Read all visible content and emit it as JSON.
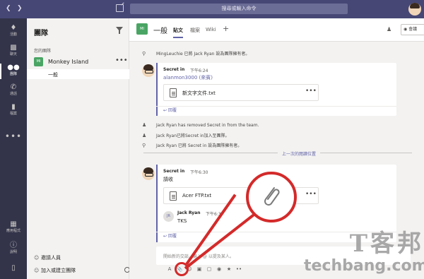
{
  "titlebar": {
    "search_placeholder": "搜尋或輸入命令"
  },
  "rail": {
    "items": [
      {
        "label": "活動",
        "icon": "bell-icon"
      },
      {
        "label": "聊天",
        "icon": "chat-icon"
      },
      {
        "label": "團隊",
        "icon": "teams-icon"
      },
      {
        "label": "通話",
        "icon": "phone-icon"
      },
      {
        "label": "檔案",
        "icon": "files-icon"
      }
    ],
    "more": "•••",
    "apps_label": "應用程式",
    "help_label": "說明"
  },
  "panel": {
    "title": "團隊",
    "section_label": "您的團隊",
    "team": {
      "avatar_text": "MI",
      "name": "Monkey Island",
      "more": "•••"
    },
    "channel": {
      "name": "一般"
    },
    "invite_label": "邀請人員",
    "join_label": "加入或建立團隊"
  },
  "header": {
    "avatar_text": "MI",
    "title": "一般",
    "tabs": [
      "貼文",
      "檔案",
      "Wiki"
    ],
    "add": "+",
    "meet_label": "會議"
  },
  "feed": {
    "sys1": "MingLeuchie 已將 Jack Ryan 設為團隊擁有者。",
    "post1": {
      "author": "Secret in",
      "time": "下午6:24",
      "text": "alanmon3000 (來賓)",
      "file": "新文字文件.txt",
      "reply": "回覆"
    },
    "sys2": "Jack Ryan has removed Secret in from the team.",
    "sys3": "Jack Ryan已將Secret in加入至團隊。",
    "sys4": "Jack Ryan 已將 Secret in 設為團隊擁有者。",
    "divider": "上一次的閱讀位置",
    "post2": {
      "author": "Secret in",
      "time": "下午6:30",
      "text": "請收",
      "file": "Acer FTP.txt",
      "sub_avatar": "JR",
      "sub_author": "Jack Ryan",
      "sub_time": "下午6:3",
      "sub_text": "TKS",
      "reply": "回覆"
    },
    "compose_placeholder": "開始新的交談。輸入 @ 以提及某人。"
  },
  "watermark": {
    "cn": "T客邦",
    "en": "techbang.com"
  }
}
